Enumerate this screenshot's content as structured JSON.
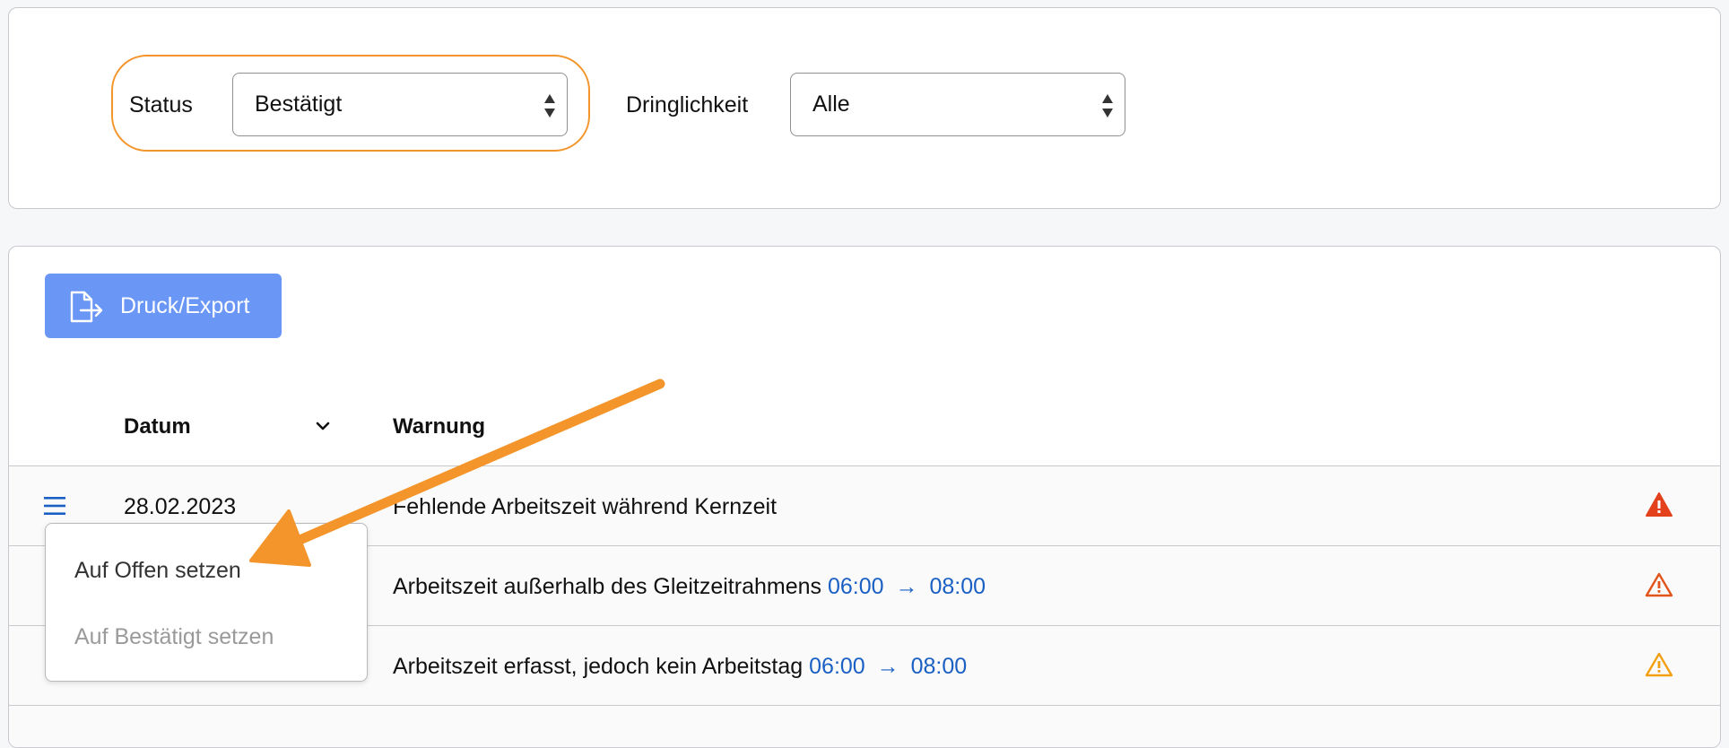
{
  "filters": {
    "status_label": "Status",
    "status_value": "Bestätigt",
    "urgency_label": "Dringlichkeit",
    "urgency_value": "Alle"
  },
  "toolbar": {
    "export_label": "Druck/Export"
  },
  "table": {
    "columns": {
      "date": "Datum",
      "warning": "Warnung"
    },
    "rows": [
      {
        "date": "28.02.2023",
        "message": "Fehlende Arbeitszeit während Kernzeit",
        "time_from": "",
        "time_to": "",
        "arrow": "",
        "severity_color": "#e2411b"
      },
      {
        "date": "",
        "message": "Arbeitszeit außerhalb des Gleitzeitrahmens",
        "time_from": "06:00",
        "arrow": "→",
        "time_to": "08:00",
        "severity_color": "#e2541b"
      },
      {
        "date": "",
        "message": "Arbeitszeit erfasst, jedoch kein Arbeitstag",
        "time_from": "06:00",
        "arrow": "→",
        "time_to": "08:00",
        "severity_color": "#f2a012"
      }
    ]
  },
  "row_menu": {
    "items": [
      {
        "label": "Auf Offen setzen",
        "enabled": true
      },
      {
        "label": "Auf Bestätigt setzen",
        "enabled": false
      }
    ]
  },
  "colors": {
    "accent_button": "#6a96f6",
    "highlight": "#f4952b",
    "time_link": "#1a5fc4"
  },
  "icons": [
    "export-icon",
    "chevron-down-icon",
    "hamburger-menu-icon",
    "warning-filled-icon",
    "warning-outline-icon"
  ]
}
